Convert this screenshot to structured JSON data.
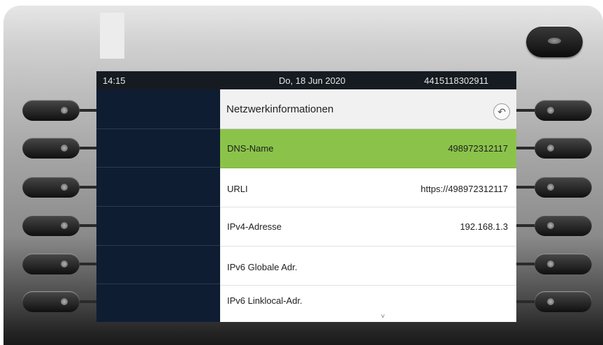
{
  "status_bar": {
    "time": "14:15",
    "date": "Do, 18 Jun 2020",
    "number": "4415118302911"
  },
  "menu": {
    "title": "Netzwerkinformationen",
    "back_icon": "back-arrow-icon",
    "items": [
      {
        "label": "DNS-Name",
        "value": "498972312117",
        "selected": true
      },
      {
        "label": "URLI",
        "value": "https://498972312117",
        "selected": false
      },
      {
        "label": "IPv4-Adresse",
        "value": "192.168.1.3",
        "selected": false
      },
      {
        "label": "IPv6 Globale Adr.",
        "value": "",
        "selected": false
      },
      {
        "label": "IPv6 Linklocal-Adr.",
        "value": "",
        "selected": false
      }
    ],
    "more_indicator": "˅"
  },
  "colors": {
    "selection": "#8bc34a",
    "left_panel": "#0f1d33",
    "status_bar": "#161b22"
  }
}
